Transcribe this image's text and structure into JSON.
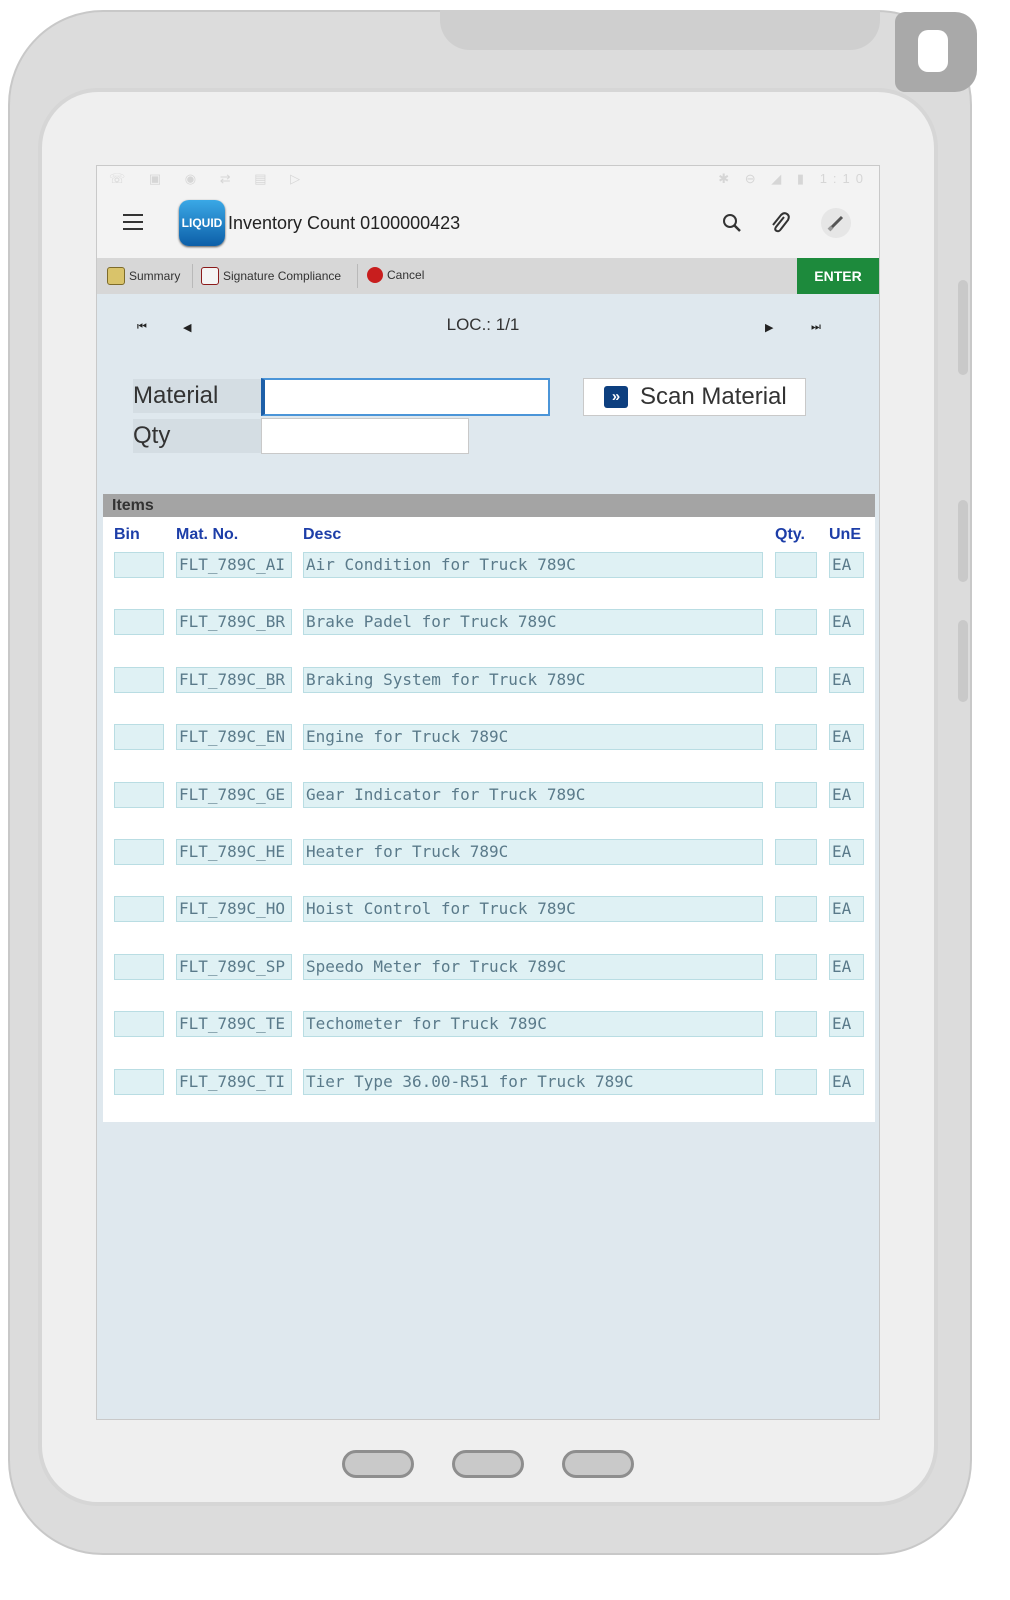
{
  "app": {
    "logo_text": "LIQUID",
    "title": "Inventory Count 0100000423"
  },
  "statusbar": {
    "left_icons": "☏ ▣ ◉ ⇄ ▤ ▷",
    "right_icons": "✱ ⊖ ◢ ▮",
    "time": "1:10"
  },
  "toolbar": {
    "summary": "Summary",
    "signature": "Signature Compliance",
    "cancel": "Cancel",
    "enter": "ENTER"
  },
  "nav": {
    "loc": "LOC.: 1/1"
  },
  "form": {
    "material_label": "Material",
    "qty_label": "Qty",
    "material_value": "",
    "qty_value": "",
    "scan_label": "Scan Material"
  },
  "items": {
    "header": "Items",
    "columns": {
      "bin": "Bin",
      "matno": "Mat. No.",
      "desc": "Desc",
      "qty": "Qty.",
      "une": "UnE"
    },
    "rows": [
      {
        "bin": "",
        "matno": "FLT_789C_AI",
        "desc": "Air Condition for Truck 789C",
        "qty": "",
        "une": "EA"
      },
      {
        "bin": "",
        "matno": "FLT_789C_BR",
        "desc": "Brake Padel for Truck 789C",
        "qty": "",
        "une": "EA"
      },
      {
        "bin": "",
        "matno": "FLT_789C_BR",
        "desc": "Braking System for Truck 789C",
        "qty": "",
        "une": "EA"
      },
      {
        "bin": "",
        "matno": "FLT_789C_EN",
        "desc": "Engine for Truck 789C",
        "qty": "",
        "une": "EA"
      },
      {
        "bin": "",
        "matno": "FLT_789C_GE",
        "desc": "Gear Indicator  for Truck 789C",
        "qty": "",
        "une": "EA"
      },
      {
        "bin": "",
        "matno": "FLT_789C_HE",
        "desc": "Heater  for Truck 789C",
        "qty": "",
        "une": "EA"
      },
      {
        "bin": "",
        "matno": "FLT_789C_HO",
        "desc": "Hoist Control for Truck 789C",
        "qty": "",
        "une": "EA"
      },
      {
        "bin": "",
        "matno": "FLT_789C_SP",
        "desc": "Speedo Meter for Truck 789C",
        "qty": "",
        "une": "EA"
      },
      {
        "bin": "",
        "matno": "FLT_789C_TE",
        "desc": "Techometer for Truck 789C",
        "qty": "",
        "une": "EA"
      },
      {
        "bin": "",
        "matno": "FLT_789C_TI",
        "desc": "Tier Type 36.00-R51 for Truck 789C",
        "qty": "",
        "une": "EA"
      }
    ]
  },
  "colors": {
    "enter_bg": "#1d8a3c",
    "header_blue": "#1d3ea8",
    "cell_bg": "#dff1f4"
  }
}
